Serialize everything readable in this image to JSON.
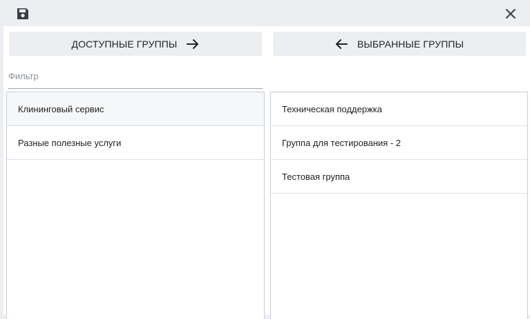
{
  "toolbar": {
    "save_icon": "floppy-disk-icon",
    "close_icon": "close-icon"
  },
  "available": {
    "button_label": "ДОСТУПНЫЕ ГРУППЫ",
    "button_icon": "arrow-right-icon",
    "filter_placeholder": "Фильтр",
    "filter_value": "",
    "items": [
      {
        "label": "Клининговый сервис"
      },
      {
        "label": "Разные полезные услуги"
      }
    ]
  },
  "selected": {
    "button_label": "ВЫБРАННЫЕ ГРУППЫ",
    "button_icon": "arrow-left-icon",
    "items": [
      {
        "label": "Техническая поддержка"
      },
      {
        "label": "Группа для тестирования - 2"
      },
      {
        "label": "Тестовая группа"
      }
    ]
  }
}
